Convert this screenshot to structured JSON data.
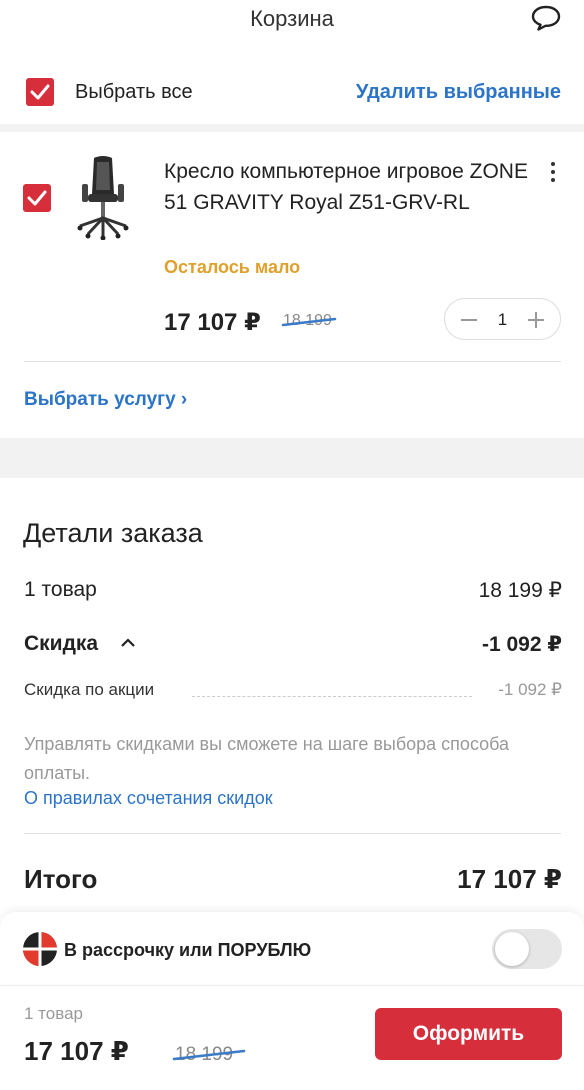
{
  "header": {
    "title": "Корзина",
    "chat_icon": "chat-bubble-icon"
  },
  "toolbar": {
    "select_all_label": "Выбрать все",
    "select_all_checked": true,
    "delete_selected_label": "Удалить выбранные"
  },
  "item": {
    "checked": true,
    "name": "Кресло компьютерное игровое ZONE 51 GRAVITY Royal Z51-GRV-RL",
    "stock_status": "Осталось мало",
    "price": "17 107 ₽",
    "old_price": "18 199",
    "quantity": "1",
    "service_link": "Выбрать услугу ›"
  },
  "details": {
    "title": "Детали заказа",
    "goods_label": "1 товар",
    "goods_value": "18 199 ₽",
    "discount_label": "Скидка",
    "discount_value": "-1 092 ₽",
    "promo_label": "Скидка по акции",
    "promo_value": "-1 092 ₽",
    "note": "Управлять скидками вы сможете на шаге выбора способа оплаты.",
    "rules_link": "О правилах сочетания скидок",
    "total_label": "Итого",
    "total_value": "17 107 ₽"
  },
  "installment": {
    "label": "В рассрочку или ПОРУБЛЮ",
    "enabled": false
  },
  "checkout": {
    "count": "1 товар",
    "total": "17 107 ₽",
    "old_price": "18 199",
    "button_label": "Оформить"
  },
  "colors": {
    "accent_red": "#d62f3b",
    "link_blue": "#2b74c8",
    "warning_orange": "#e0a02c"
  }
}
